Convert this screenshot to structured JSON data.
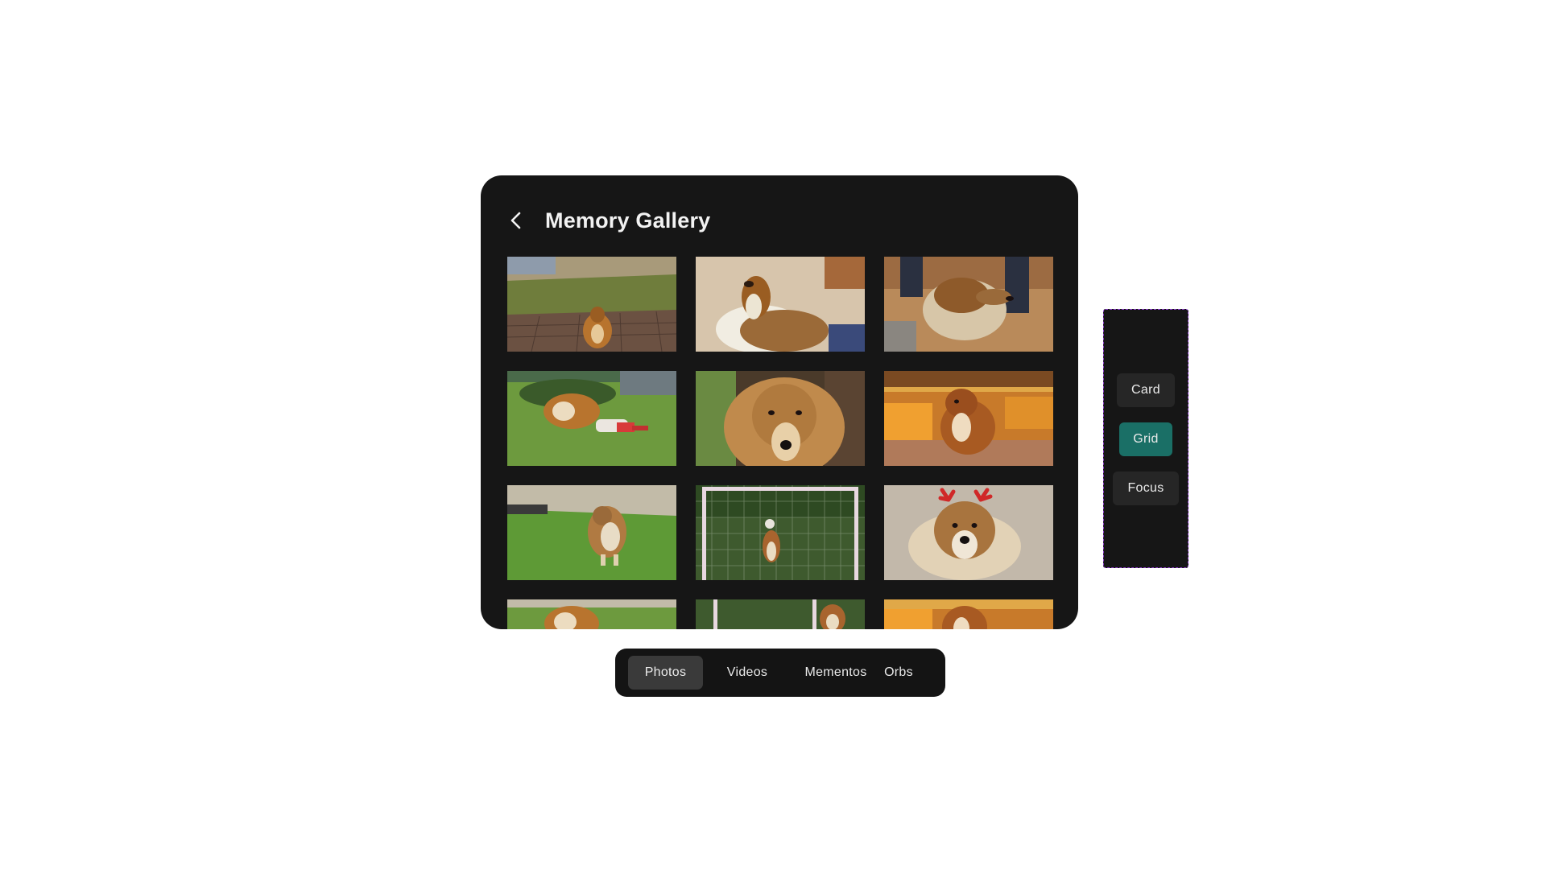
{
  "header": {
    "title": "Memory Gallery",
    "back_icon": "chevron-left-icon"
  },
  "photos": [
    {
      "subject": "collie on wooden deck by lake"
    },
    {
      "subject": "collie lying on floor"
    },
    {
      "subject": "collie close-up indoors"
    },
    {
      "subject": "collie playing on grass"
    },
    {
      "subject": "collie face close-up"
    },
    {
      "subject": "collie puppy sitting indoors"
    },
    {
      "subject": "collie on grass"
    },
    {
      "subject": "collie jumping at soccer goal"
    },
    {
      "subject": "collie with antlers headband"
    },
    {
      "subject": "collie on grass"
    },
    {
      "subject": "collie at soccer goal"
    },
    {
      "subject": "collie indoors"
    }
  ],
  "tabs": [
    {
      "label": "Photos",
      "active": true
    },
    {
      "label": "Videos",
      "active": false
    },
    {
      "label": "Mementos",
      "active": false
    },
    {
      "label": "Orbs",
      "active": false
    }
  ],
  "view_modes": [
    {
      "label": "Card",
      "active": false
    },
    {
      "label": "Grid",
      "active": true
    },
    {
      "label": "Focus",
      "active": false
    }
  ],
  "colors": {
    "panel_bg": "#161616",
    "accent": "#1a6f66",
    "active_tab": "#3a3a3a",
    "panel_outline": "#8a3cc9"
  }
}
